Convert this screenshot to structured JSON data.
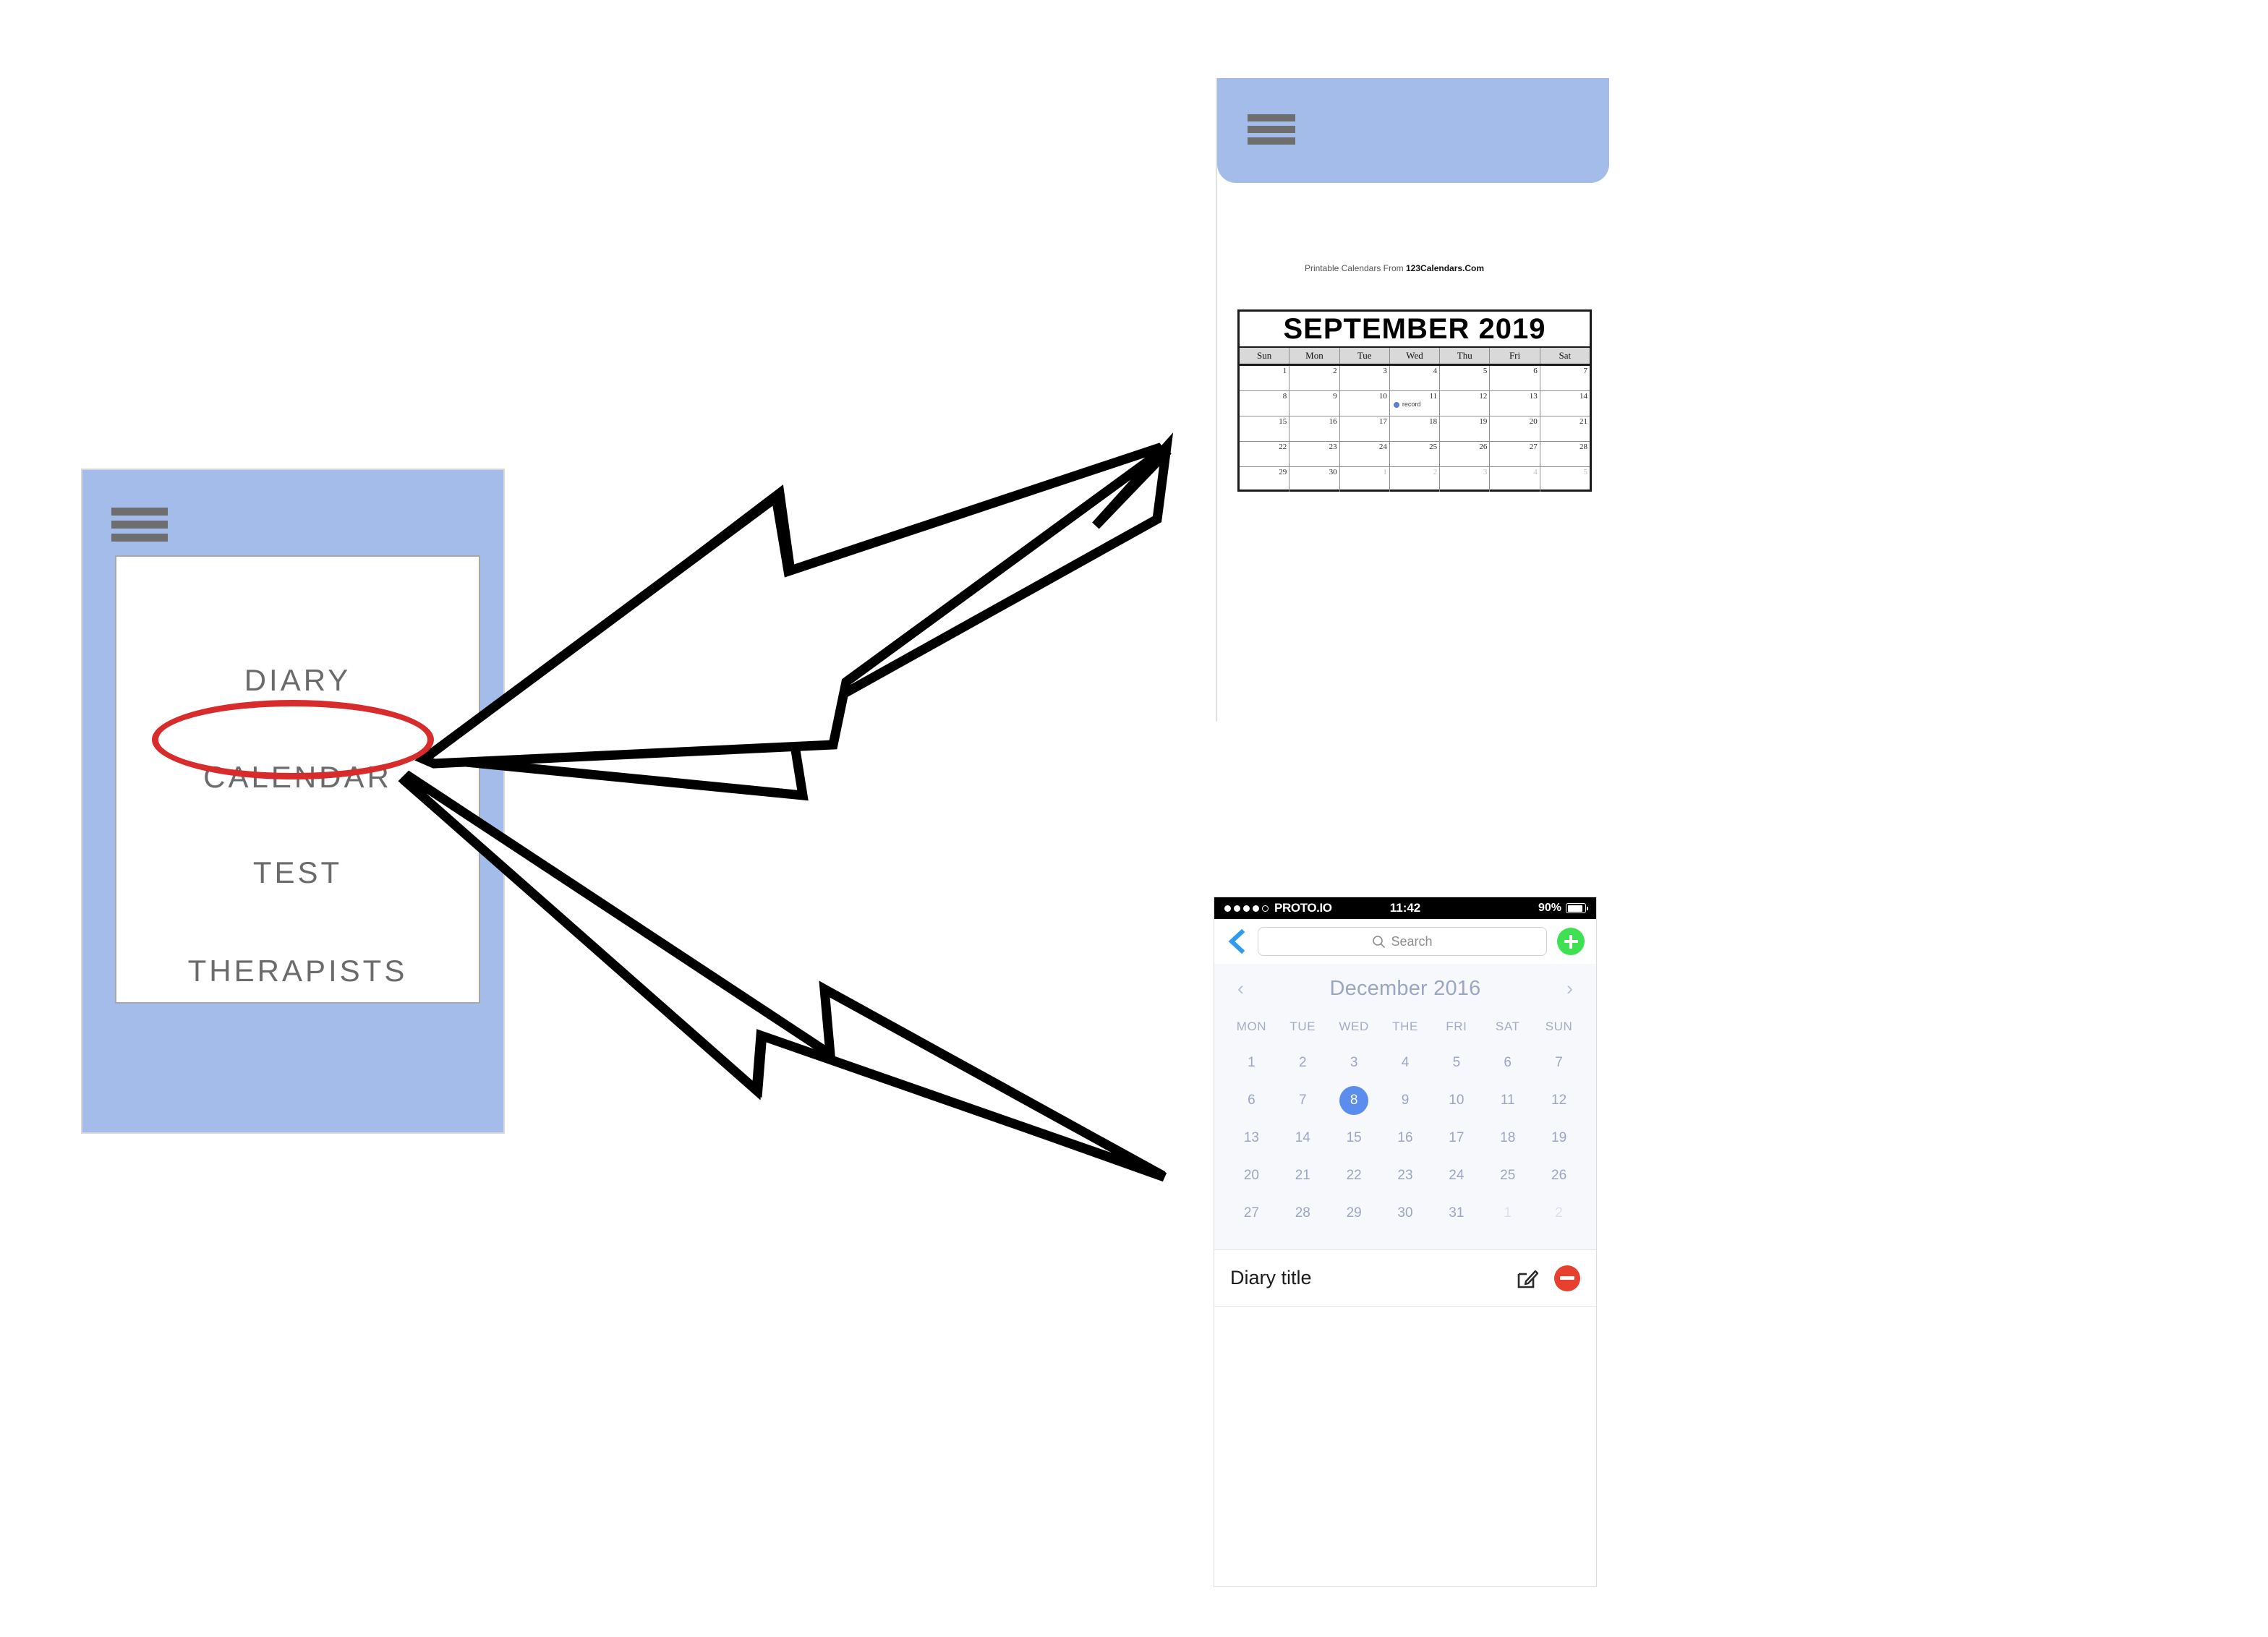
{
  "left_phone": {
    "menu_icon": "hamburger-menu-icon",
    "menu_items": [
      {
        "label": "DIARY"
      },
      {
        "label": "CALENDAR"
      },
      {
        "label": "TEST"
      },
      {
        "label": "THERAPISTS"
      }
    ],
    "highlight_color": "#D82B2B",
    "highlighted_item": "CALENDAR",
    "background_color": "#A3BCEA"
  },
  "top_right_phone": {
    "menu_icon": "hamburger-menu-icon",
    "header_color": "#A3BCEA",
    "calendar_image": {
      "title": "SEPTEMBER 2019",
      "day_headers": [
        "Sun",
        "Mon",
        "Tue",
        "Wed",
        "Thu",
        "Fri",
        "Sat"
      ],
      "weeks": [
        [
          {
            "n": "1",
            "muted": false
          },
          {
            "n": "2",
            "muted": false
          },
          {
            "n": "3",
            "muted": false
          },
          {
            "n": "4",
            "muted": false
          },
          {
            "n": "5",
            "muted": false
          },
          {
            "n": "6",
            "muted": false
          },
          {
            "n": "7",
            "muted": false
          }
        ],
        [
          {
            "n": "8",
            "muted": false
          },
          {
            "n": "9",
            "muted": false
          },
          {
            "n": "10",
            "muted": false
          },
          {
            "n": "11",
            "muted": false,
            "event": "record"
          },
          {
            "n": "12",
            "muted": false
          },
          {
            "n": "13",
            "muted": false
          },
          {
            "n": "14",
            "muted": false
          }
        ],
        [
          {
            "n": "15",
            "muted": false
          },
          {
            "n": "16",
            "muted": false
          },
          {
            "n": "17",
            "muted": false
          },
          {
            "n": "18",
            "muted": false
          },
          {
            "n": "19",
            "muted": false
          },
          {
            "n": "20",
            "muted": false
          },
          {
            "n": "21",
            "muted": false
          }
        ],
        [
          {
            "n": "22",
            "muted": false
          },
          {
            "n": "23",
            "muted": false
          },
          {
            "n": "24",
            "muted": false
          },
          {
            "n": "25",
            "muted": false
          },
          {
            "n": "26",
            "muted": false
          },
          {
            "n": "27",
            "muted": false
          },
          {
            "n": "28",
            "muted": false
          }
        ],
        [
          {
            "n": "29",
            "muted": false
          },
          {
            "n": "30",
            "muted": false
          },
          {
            "n": "1",
            "muted": true
          },
          {
            "n": "2",
            "muted": true
          },
          {
            "n": "3",
            "muted": true
          },
          {
            "n": "4",
            "muted": true
          },
          {
            "n": "5",
            "muted": true
          }
        ]
      ],
      "event_dot_color": "#5B7FD4",
      "footer_prefix": "Printable Calendars From ",
      "footer_site": "123Calendars.Com"
    }
  },
  "bottom_right_phone": {
    "status_bar": {
      "carrier": "PROTO.IO",
      "time": "11:42",
      "battery_percent": "90%",
      "signal_icon": "signal-dots-icon",
      "battery_icon": "battery-icon"
    },
    "nav_bar": {
      "back_icon": "back-chevron-icon",
      "search_placeholder": "Search",
      "search_value": "",
      "search_icon": "search-icon",
      "add_icon": "plus-circle-icon",
      "add_color": "#3FE051"
    },
    "calendar": {
      "month_label": "December 2016",
      "prev_icon": "chevron-left-icon",
      "next_icon": "chevron-right-icon",
      "day_headers": [
        "MON",
        "TUE",
        "WED",
        "THE",
        "FRI",
        "SAT",
        "SUN"
      ],
      "selected_day": "8",
      "selected_color": "#5B8DEF",
      "weeks": [
        [
          {
            "n": "1",
            "state": "normal"
          },
          {
            "n": "2",
            "state": "normal"
          },
          {
            "n": "3",
            "state": "normal"
          },
          {
            "n": "4",
            "state": "normal"
          },
          {
            "n": "5",
            "state": "normal"
          },
          {
            "n": "6",
            "state": "normal"
          },
          {
            "n": "7",
            "state": "normal"
          }
        ],
        [
          {
            "n": "6",
            "state": "normal"
          },
          {
            "n": "7",
            "state": "normal"
          },
          {
            "n": "8",
            "state": "selected"
          },
          {
            "n": "9",
            "state": "normal"
          },
          {
            "n": "10",
            "state": "normal"
          },
          {
            "n": "11",
            "state": "normal"
          },
          {
            "n": "12",
            "state": "normal"
          }
        ],
        [
          {
            "n": "13",
            "state": "normal"
          },
          {
            "n": "14",
            "state": "normal"
          },
          {
            "n": "15",
            "state": "normal"
          },
          {
            "n": "16",
            "state": "normal"
          },
          {
            "n": "17",
            "state": "normal"
          },
          {
            "n": "18",
            "state": "normal"
          },
          {
            "n": "19",
            "state": "normal"
          }
        ],
        [
          {
            "n": "20",
            "state": "normal"
          },
          {
            "n": "21",
            "state": "normal"
          },
          {
            "n": "22",
            "state": "normal"
          },
          {
            "n": "23",
            "state": "normal"
          },
          {
            "n": "24",
            "state": "normal"
          },
          {
            "n": "25",
            "state": "normal"
          },
          {
            "n": "26",
            "state": "normal"
          }
        ],
        [
          {
            "n": "27",
            "state": "normal"
          },
          {
            "n": "28",
            "state": "normal"
          },
          {
            "n": "29",
            "state": "normal"
          },
          {
            "n": "30",
            "state": "normal"
          },
          {
            "n": "31",
            "state": "normal"
          },
          {
            "n": "1",
            "state": "muted"
          },
          {
            "n": "2",
            "state": "muted"
          }
        ]
      ]
    },
    "diary_entry": {
      "title": "Diary title",
      "edit_icon": "edit-pencil-icon",
      "delete_icon": "remove-circle-icon",
      "delete_color": "#E8402F"
    }
  },
  "annotations": {
    "arrow_upper": "arrow-calendar-to-september-screen",
    "arrow_lower": "arrow-calendar-to-diary-screen",
    "arrow_color": "#000000"
  }
}
